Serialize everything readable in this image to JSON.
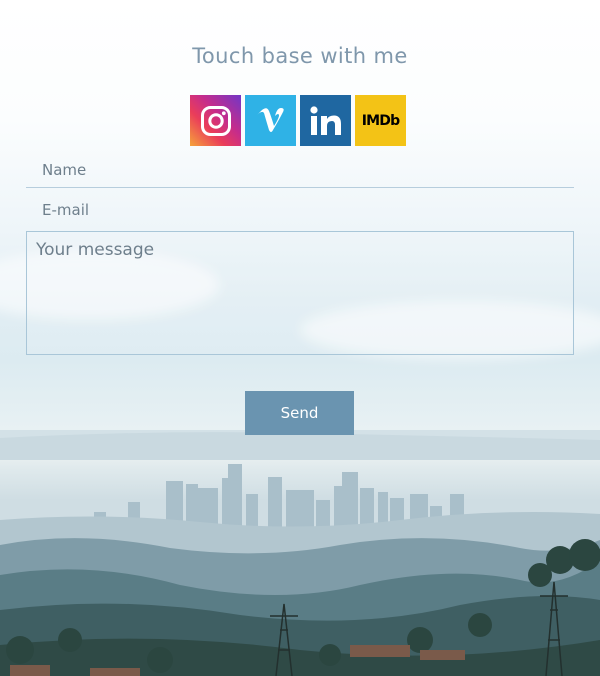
{
  "page": {
    "heading": "Touch base with me"
  },
  "social": [
    {
      "id": "instagram",
      "icon": "instagram-icon",
      "color": "#d6317c"
    },
    {
      "id": "vimeo",
      "icon": "vimeo-icon",
      "color": "#2fb2e6"
    },
    {
      "id": "linkedin",
      "icon": "linkedin-icon",
      "color": "#1f67a1"
    },
    {
      "id": "imdb",
      "icon": "imdb-icon",
      "label": "IMDb",
      "color": "#f3c316"
    }
  ],
  "form": {
    "name_placeholder": "Name",
    "email_placeholder": "E-mail",
    "message_placeholder": "Your message",
    "send_label": "Send"
  },
  "colors": {
    "accent": "#6a94b0",
    "heading": "#7f97ab",
    "field_border": "#b7cddd"
  }
}
